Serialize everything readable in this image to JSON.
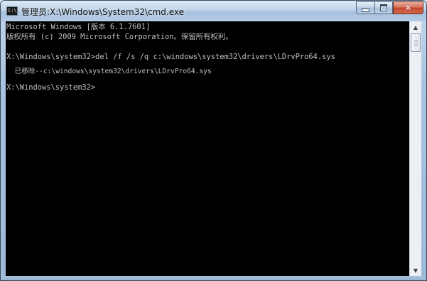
{
  "window": {
    "title": "管理员:X:\\Windows\\System32\\cmd.exe",
    "icon_text": "C:\\"
  },
  "controls": {
    "minimize": "minimize-icon",
    "maximize": "maximize-icon",
    "close": "✕"
  },
  "console": {
    "lines": [
      "Microsoft Windows [版本 6.1.7601]",
      "版权所有 (c) 2009 Microsoft Corporation。保留所有权利。",
      "",
      "X:\\Windows\\system32>del /f /s /q c:\\windows\\system32\\drivers\\LDrvPro64.sys",
      "  已移除--c:\\windows\\system32\\drivers\\LDrvPro64.sys",
      "",
      "X:\\Windows\\system32>"
    ],
    "colors": {
      "background": "#000000",
      "text": "#c0c0c0"
    }
  },
  "scrollbar": {
    "up": "▲",
    "down": "▼"
  }
}
